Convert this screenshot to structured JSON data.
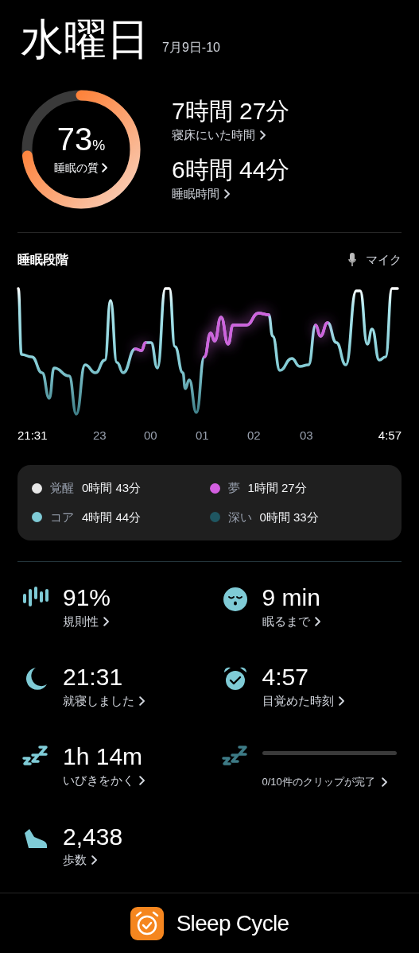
{
  "header": {
    "day": "水曜日",
    "date": "7月9日-10"
  },
  "quality": {
    "value": "73",
    "unit": "%",
    "label": "睡眠の質"
  },
  "durations": [
    {
      "value": "7時間 27分",
      "label": "寝床にいた時間"
    },
    {
      "value": "6時間 44分",
      "label": "睡眠時間"
    }
  ],
  "stages": {
    "title": "睡眠段階",
    "mic": "マイク",
    "time_labels": [
      "21:31",
      "23",
      "00",
      "01",
      "02",
      "03",
      "4:57"
    ],
    "legend": [
      {
        "name": "覚醒",
        "value": "0時間 43分",
        "color": "#e6e6e6"
      },
      {
        "name": "夢",
        "value": "1時間 27分",
        "color": "#d35fe0"
      },
      {
        "name": "コア",
        "value": "4時間 44分",
        "color": "#7fcbd6"
      },
      {
        "name": "深い",
        "value": "0時間 33分",
        "color": "#1f5661"
      }
    ]
  },
  "stats": [
    {
      "kind": "stat",
      "value": "91%",
      "label": "規則性"
    },
    {
      "kind": "stat",
      "value": "9 min",
      "label": "眠るまで"
    },
    {
      "kind": "stat",
      "value": "21:31",
      "label": "就寝しました"
    },
    {
      "kind": "stat",
      "value": "4:57",
      "label": "目覚めた時刻"
    },
    {
      "kind": "stat",
      "value": "1h 14m",
      "label": "いびきをかく"
    },
    {
      "kind": "clips",
      "label": "0/10件のクリップが完了",
      "level": 0
    },
    {
      "kind": "stat",
      "value": "2,438",
      "label": "歩数"
    }
  ],
  "footer": {
    "app_name": "Sleep Cycle"
  }
}
